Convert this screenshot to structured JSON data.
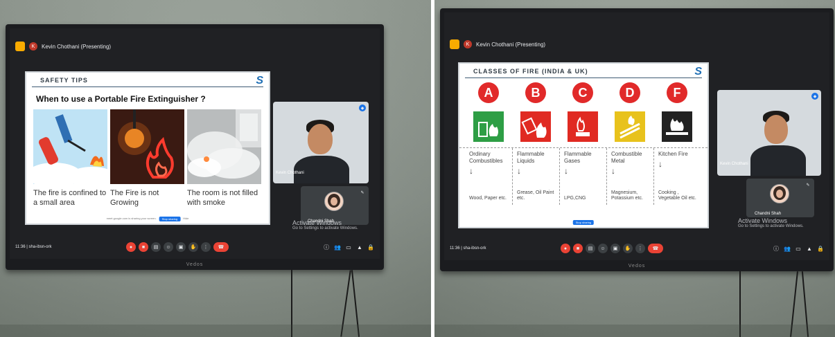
{
  "left_screen": {
    "presenter": "Kevin Chothani (Presenting)",
    "slide": {
      "header": "SAFETY TIPS",
      "subtitle": "When to use a Portable Fire Extinguisher ?",
      "tips": [
        {
          "text": "The fire is confined to a small area"
        },
        {
          "text": "The Fire is not Growing"
        },
        {
          "text": "The room is not filled with smoke"
        }
      ],
      "share_bar_text": "meet.google.com is sharing your screen.",
      "stop_sharing": "Stop sharing",
      "hide": "Hide"
    },
    "speaker_name": "Kevin Chothani",
    "self_name": "Chandni Shah",
    "watermark_title": "Activate Windows",
    "watermark_sub": "Go to Settings to activate Windows.",
    "meeting_time": "11:36",
    "meeting_code": "sha-ibsn-ork",
    "tv_brand": "Vedos"
  },
  "right_screen": {
    "presenter": "Kevin Chothani (Presenting)",
    "slide": {
      "header": "CLASSES OF FIRE (INDIA & UK)",
      "classes": [
        {
          "letter": "A",
          "type": "Ordinary Combustibles",
          "examples": "Wood, Paper etc."
        },
        {
          "letter": "B",
          "type": "Flammable Liquids",
          "examples": "Grease, Oil Paint etc."
        },
        {
          "letter": "C",
          "type": "Flammable Gases",
          "examples": "LPG,CNG"
        },
        {
          "letter": "D",
          "type": "Combustible Metal",
          "examples": "Magnesium, Potassium etc."
        },
        {
          "letter": "F",
          "type": "Kitchen Fire",
          "examples": "Cooking , Vegetable Oil etc."
        }
      ],
      "stop_sharing": "Stop sharing"
    },
    "speaker_name": "Kevin Chothani",
    "self_name": "Chandni Shah",
    "watermark_title": "Activate Windows",
    "watermark_sub": "Go to Settings to activate Windows.",
    "meeting_time": "11:36",
    "meeting_code": "sha-ibsn-ork",
    "tv_brand": "Vedos"
  },
  "colors": {
    "fire_red": "#e12a2a",
    "class_a_green": "#2e9e45",
    "class_c_red": "#e02a22",
    "class_d_yellow": "#e8c21c",
    "class_f_black": "#222222",
    "meet_bar": "#202124",
    "hangup": "#ea4335"
  }
}
